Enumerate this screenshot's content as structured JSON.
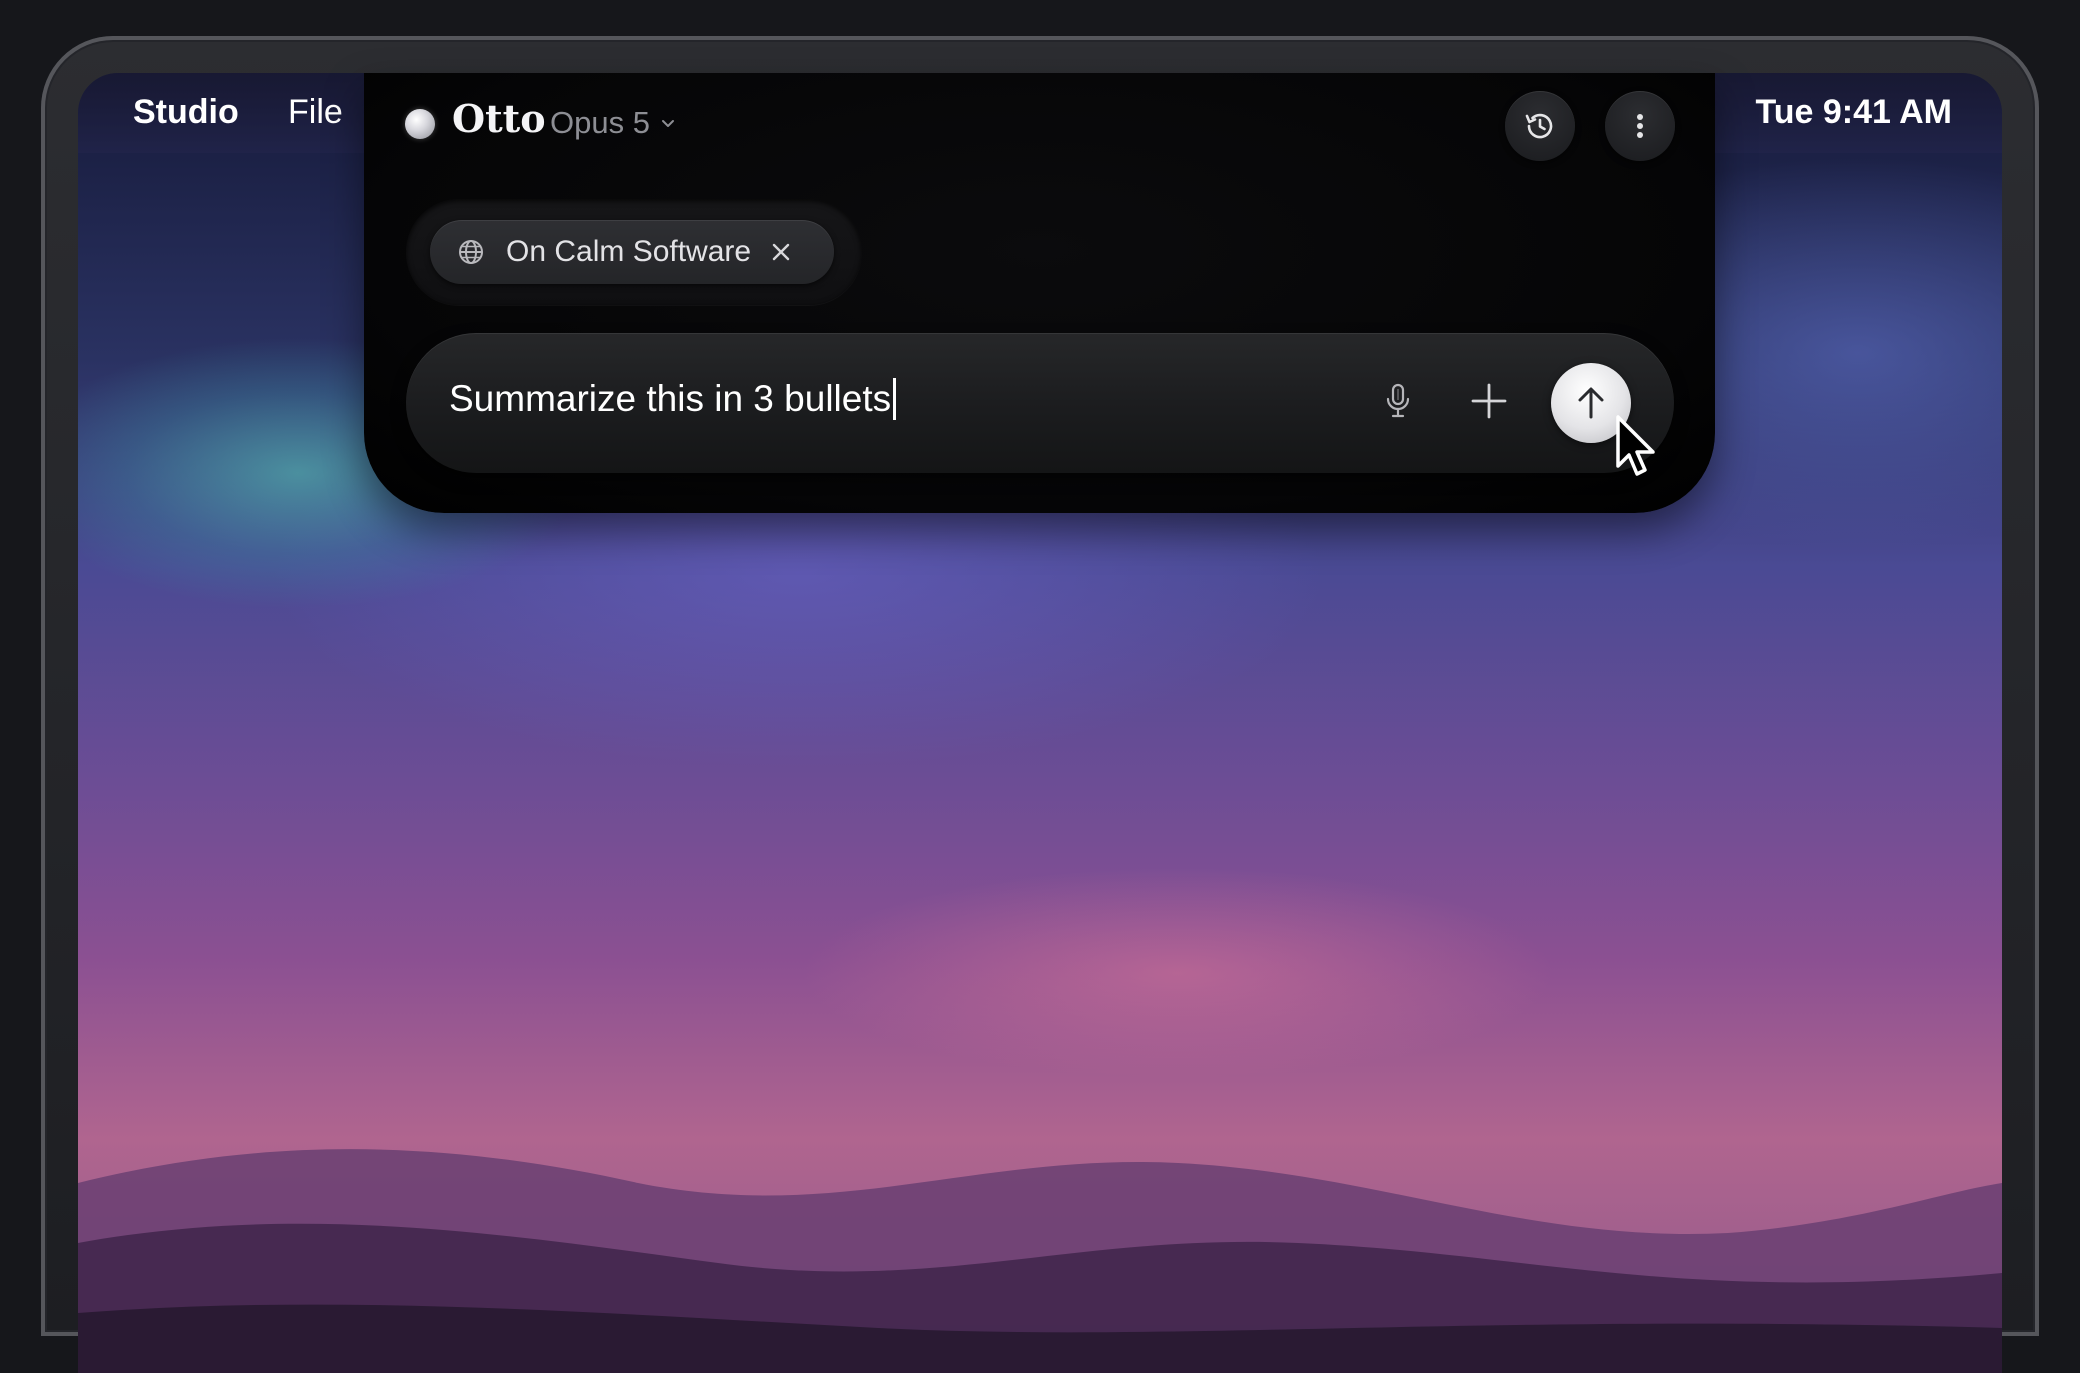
{
  "menubar": {
    "app_name": "Studio",
    "file_menu": "File",
    "clock": "Tue 9:41 AM"
  },
  "assistant": {
    "name": "Otto",
    "model": "Opus 5",
    "context_chip": {
      "label": "On Calm Software",
      "icon": "globe-icon"
    },
    "input": {
      "value": "Summarize this in 3 bullets"
    },
    "buttons": {
      "history": "history-icon",
      "more": "more-vertical-icon",
      "mic": "microphone-icon",
      "add": "plus-icon",
      "send": "arrow-up-icon"
    }
  },
  "colors": {
    "panel": "#050506",
    "send_button": "#e4e4e7",
    "model_text": "#8d8e94"
  }
}
